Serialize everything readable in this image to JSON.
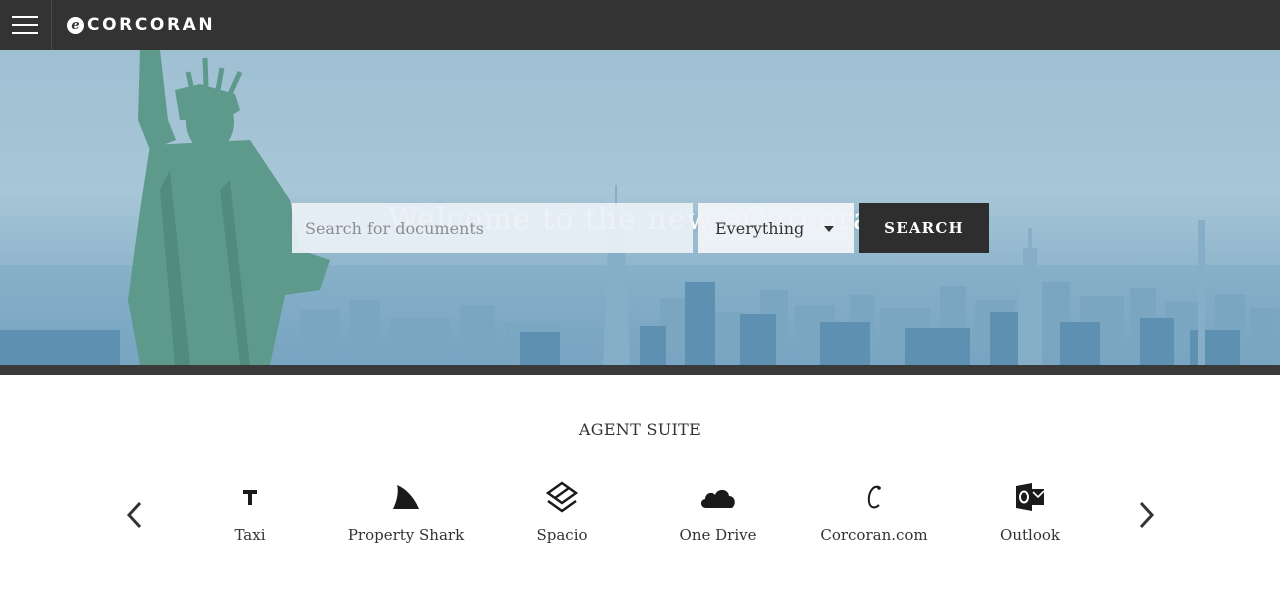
{
  "header": {
    "logo_mark": "e",
    "logo_text": "CORCORAN"
  },
  "hero": {
    "title": "Welcome to the new eCorcoran",
    "search": {
      "placeholder": "Search for documents",
      "value": "",
      "scope_selected": "Everything",
      "button_label": "SEARCH"
    }
  },
  "suite": {
    "title": "AGENT SUITE",
    "apps": [
      {
        "label": "Taxi",
        "icon": "taxi-icon"
      },
      {
        "label": "Property Shark",
        "icon": "shark-fin-icon"
      },
      {
        "label": "Spacio",
        "icon": "spacio-icon"
      },
      {
        "label": "One Drive",
        "icon": "cloud-icon"
      },
      {
        "label": "Corcoran.com",
        "icon": "corcoran-c-icon"
      },
      {
        "label": "Outlook",
        "icon": "outlook-icon"
      }
    ]
  },
  "colors": {
    "topbar": "#333333",
    "button": "#2e2e2e",
    "text": "#333333"
  }
}
